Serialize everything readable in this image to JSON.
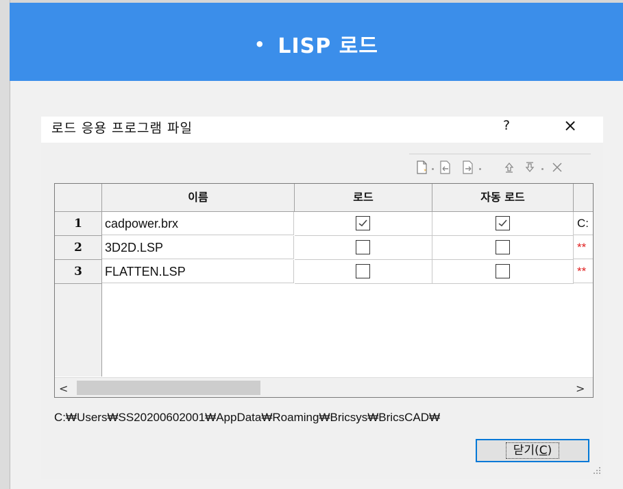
{
  "banner": {
    "bullet": "•",
    "title": "LISP 로드"
  },
  "dialog": {
    "title": "로드 응용 프로그램 파일",
    "help": "?",
    "close_icon": "×",
    "toolbar": [
      "new-file-icon",
      "move-left-icon",
      "move-right-icon",
      "move-up-icon",
      "move-down-icon",
      "delete-icon"
    ],
    "columns": {
      "name": "이름",
      "load": "로드",
      "autoload": "자동 로드"
    },
    "rows": [
      {
        "num": "1",
        "name": "cadpower.brx",
        "load": true,
        "autoload": true,
        "path": "C:"
      },
      {
        "num": "2",
        "name": "3D2D.LSP",
        "load": false,
        "autoload": false,
        "path": "**"
      },
      {
        "num": "3",
        "name": "FLATTEN.LSP",
        "load": false,
        "autoload": false,
        "path": "**"
      }
    ],
    "path_text": "C:₩Users₩SS20200602001₩AppData₩Roaming₩Bricsys₩BricsCAD₩",
    "close_button": {
      "prefix": "닫기(",
      "key": "C",
      "suffix": ")"
    },
    "colors": {
      "banner": "#3b8eea",
      "path_warn": "#e02020",
      "focus": "#0078d7"
    }
  }
}
